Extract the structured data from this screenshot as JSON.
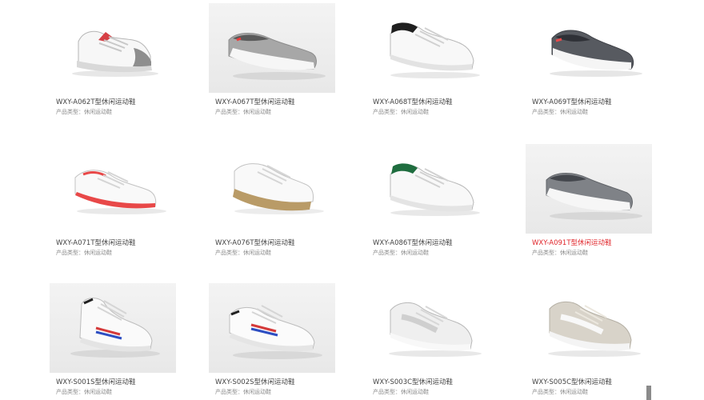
{
  "products": [
    {
      "title": "WXY-A062T型休闲运动鞋",
      "meta": "产品类型：休闲运动鞋",
      "icon": "white-sneaker-gray-heel",
      "active": false,
      "gray_bg": false
    },
    {
      "title": "WXY-A067T型休闲运动鞋",
      "meta": "产品类型：休闲运动鞋",
      "icon": "gray-slip-on",
      "active": false,
      "gray_bg": true
    },
    {
      "title": "WXY-A068T型休闲运动鞋",
      "meta": "产品类型：休闲运动鞋",
      "icon": "white-sneaker-black-collar",
      "active": false,
      "gray_bg": false
    },
    {
      "title": "WXY-A069T型休闲运动鞋",
      "meta": "产品类型：休闲运动鞋",
      "icon": "dark-gray-slip-on",
      "active": false,
      "gray_bg": false
    },
    {
      "title": "WXY-A071T型休闲运动鞋",
      "meta": "产品类型：休闲运动鞋",
      "icon": "white-canvas-red-trim",
      "active": false,
      "gray_bg": false
    },
    {
      "title": "WXY-A076T型休闲运动鞋",
      "meta": "产品类型：休闲运动鞋",
      "icon": "white-canvas-gum-sole",
      "active": false,
      "gray_bg": false
    },
    {
      "title": "WXY-A086T型休闲运动鞋",
      "meta": "产品类型：休闲运动鞋",
      "icon": "white-sneaker-green-collar",
      "active": false,
      "gray_bg": false
    },
    {
      "title": "WXY-A091T型休闲运动鞋",
      "meta": "产品类型：休闲运动鞋",
      "icon": "gray-slip-on",
      "active": true,
      "gray_bg": true
    },
    {
      "title": "WXY-S001S型休闲运动鞋",
      "meta": "产品类型：休闲运动鞋",
      "icon": "white-high-top-stripes",
      "active": false,
      "gray_bg": true
    },
    {
      "title": "WXY-S002S型休闲运动鞋",
      "meta": "产品类型：休闲运动鞋",
      "icon": "white-low-top-stripes",
      "active": false,
      "gray_bg": true
    },
    {
      "title": "WXY-S003C型休闲运动鞋",
      "meta": "产品类型：休闲运动鞋",
      "icon": "light-gray-sneaker",
      "active": false,
      "gray_bg": false
    },
    {
      "title": "WXY-S005C型休闲运动鞋",
      "meta": "产品类型：休闲运动鞋",
      "icon": "beige-gray-sneaker",
      "active": false,
      "gray_bg": false
    }
  ]
}
